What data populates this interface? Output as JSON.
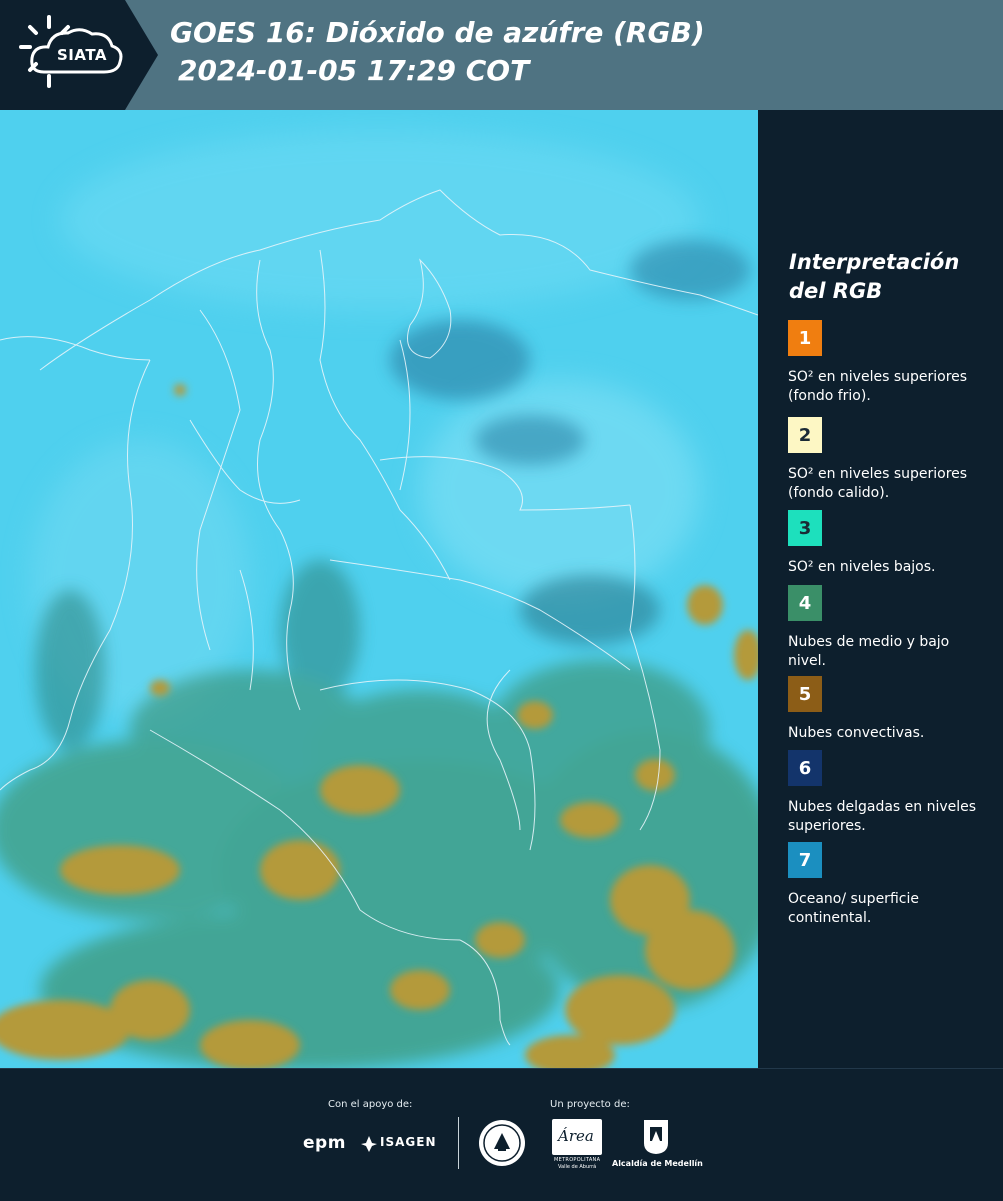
{
  "header": {
    "logo_text": "SIATA",
    "title_line1": "GOES 16: Dióxido de azúfre (RGB)",
    "title_line2": "2024-01-05 17:29 COT",
    "header_color": "#4f7382"
  },
  "legend": {
    "title_line1": "Interpretación",
    "title_line2": "del RGB",
    "items": [
      {
        "number": "1",
        "color": "#f07e10",
        "text_color": "#ffffff",
        "label": "SO² en niveles superiores (fondo frio)."
      },
      {
        "number": "2",
        "color": "#fdf7c4",
        "text_color": "#1a2a35",
        "label": "SO² en niveles superiores (fondo calido)."
      },
      {
        "number": "3",
        "color": "#1de0bd",
        "text_color": "#1a2a35",
        "label": "SO² en niveles bajos."
      },
      {
        "number": "4",
        "color": "#3a8f68",
        "text_color": "#ffffff",
        "label": "Nubes de medio y bajo nivel."
      },
      {
        "number": "5",
        "color": "#8c5d17",
        "text_color": "#ffffff",
        "label": "Nubes convectivas."
      },
      {
        "number": "6",
        "color": "#13346b",
        "text_color": "#ffffff",
        "label": "Nubes delgadas en niveles superiores."
      },
      {
        "number": "7",
        "color": "#1b8fc0",
        "text_color": "#ffffff",
        "label": "Oceano/ superficie continental."
      }
    ]
  },
  "map": {
    "base_color": "#4fd0ee",
    "cloud_color": "#b49a3a",
    "border_color": "#e6f4fa"
  },
  "footer": {
    "support_label": "Con el apoyo de:",
    "project_label": "Un proyecto de:",
    "epm_logo": "epm",
    "isagen_logo": "ISAGEN",
    "metro_logo_main": "Área",
    "metro_logo_sub1": "METROPOLITANA",
    "metro_logo_sub2": "Valle de Aburrá",
    "alcaldia_logo": "Alcaldía de Medellín"
  }
}
